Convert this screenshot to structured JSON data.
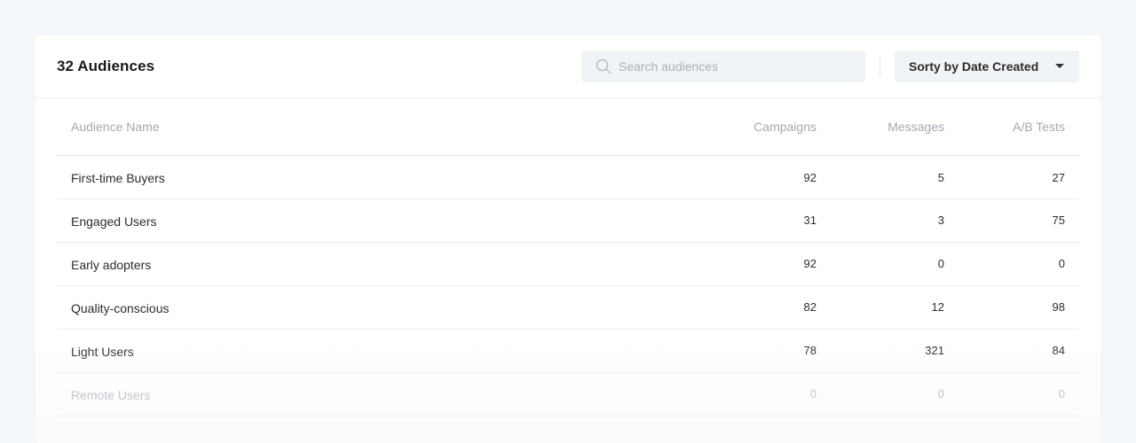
{
  "header": {
    "title": "32 Audiences",
    "search_placeholder": "Search audiences",
    "sort_label": "Sorty by Date Created"
  },
  "table": {
    "columns": [
      "Audience Name",
      "Campaigns",
      "Messages",
      "A/B Tests"
    ],
    "rows": [
      {
        "name": "First-time Buyers",
        "campaigns": "92",
        "messages": "5",
        "ab_tests": "27"
      },
      {
        "name": "Engaged Users",
        "campaigns": "31",
        "messages": "3",
        "ab_tests": "75"
      },
      {
        "name": "Early adopters",
        "campaigns": "92",
        "messages": "0",
        "ab_tests": "0"
      },
      {
        "name": "Quality-conscious",
        "campaigns": "82",
        "messages": "12",
        "ab_tests": "98"
      },
      {
        "name": "Light Users",
        "campaigns": "78",
        "messages": "321",
        "ab_tests": "84"
      },
      {
        "name": "Remote Users",
        "campaigns": "0",
        "messages": "0",
        "ab_tests": "0"
      }
    ]
  },
  "icons": {
    "search": "search-icon",
    "sort_caret": "caret-down-icon"
  },
  "colors": {
    "page_background": "#f4f7f9",
    "card_background": "#ffffff",
    "input_background": "#f1f4f7",
    "header_text": "#a3a9af"
  }
}
